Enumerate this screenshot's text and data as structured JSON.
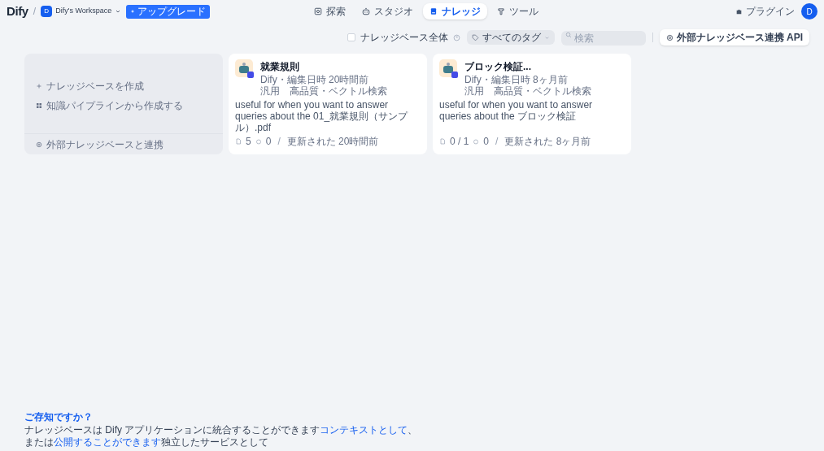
{
  "header": {
    "logo": "Dify",
    "workspace": {
      "initial": "D",
      "name": "Dify's Workspace"
    },
    "upgrade": "アップグレード",
    "separator": "/",
    "nav": [
      {
        "label": "探索",
        "selected": false
      },
      {
        "label": "スタジオ",
        "selected": false
      },
      {
        "label": "ナレッジ",
        "selected": true
      },
      {
        "label": "ツール",
        "selected": false
      }
    ],
    "plugins": "プラグイン",
    "avatar": "D"
  },
  "toolbar": {
    "all_knowledge": {
      "label": "ナレッジベース全体",
      "checked": false
    },
    "tags": "すべてのタグ",
    "search": {
      "placeholder": "検索"
    },
    "api_button": "外部ナレッジベース連携 API"
  },
  "create_card": {
    "items": [
      "ナレッジベースを作成",
      "知識パイプラインから作成する"
    ],
    "connect": "外部ナレッジベースと連携"
  },
  "datasets": [
    {
      "name": "就業規則",
      "meta": "Dify・編集日時 20時間前",
      "tags": "汎用　高品質・ベクトル検索",
      "description": "useful for when you want to answer queries about the 01_就業規則（サンプル）.pdf",
      "docs": "5",
      "apps": "0",
      "separator": "/",
      "updated": "更新された 20時間前"
    },
    {
      "name": "ブロック検証...",
      "meta": "Dify・編集日時 8ヶ月前",
      "tags": "汎用　高品質・ベクトル検索",
      "description": "useful for when you want to answer queries about the ブロック検証",
      "docs": "0 / 1",
      "apps": "0",
      "separator": "/",
      "updated": "更新された 8ヶ月前"
    }
  ],
  "tip": {
    "title": "ご存知ですか？",
    "lines": [
      [
        {
          "kind": "text",
          "text": "ナレッジベースは Dify アプリケーションに統合することができます"
        },
        {
          "kind": "link",
          "text": "コンテキストとして"
        },
        {
          "kind": "text",
          "text": "、"
        }
      ],
      [
        {
          "kind": "text",
          "text": "または"
        },
        {
          "kind": "link",
          "text": "公開することができます"
        },
        {
          "kind": "text",
          "text": "独立したサービスとして"
        }
      ]
    ]
  }
}
